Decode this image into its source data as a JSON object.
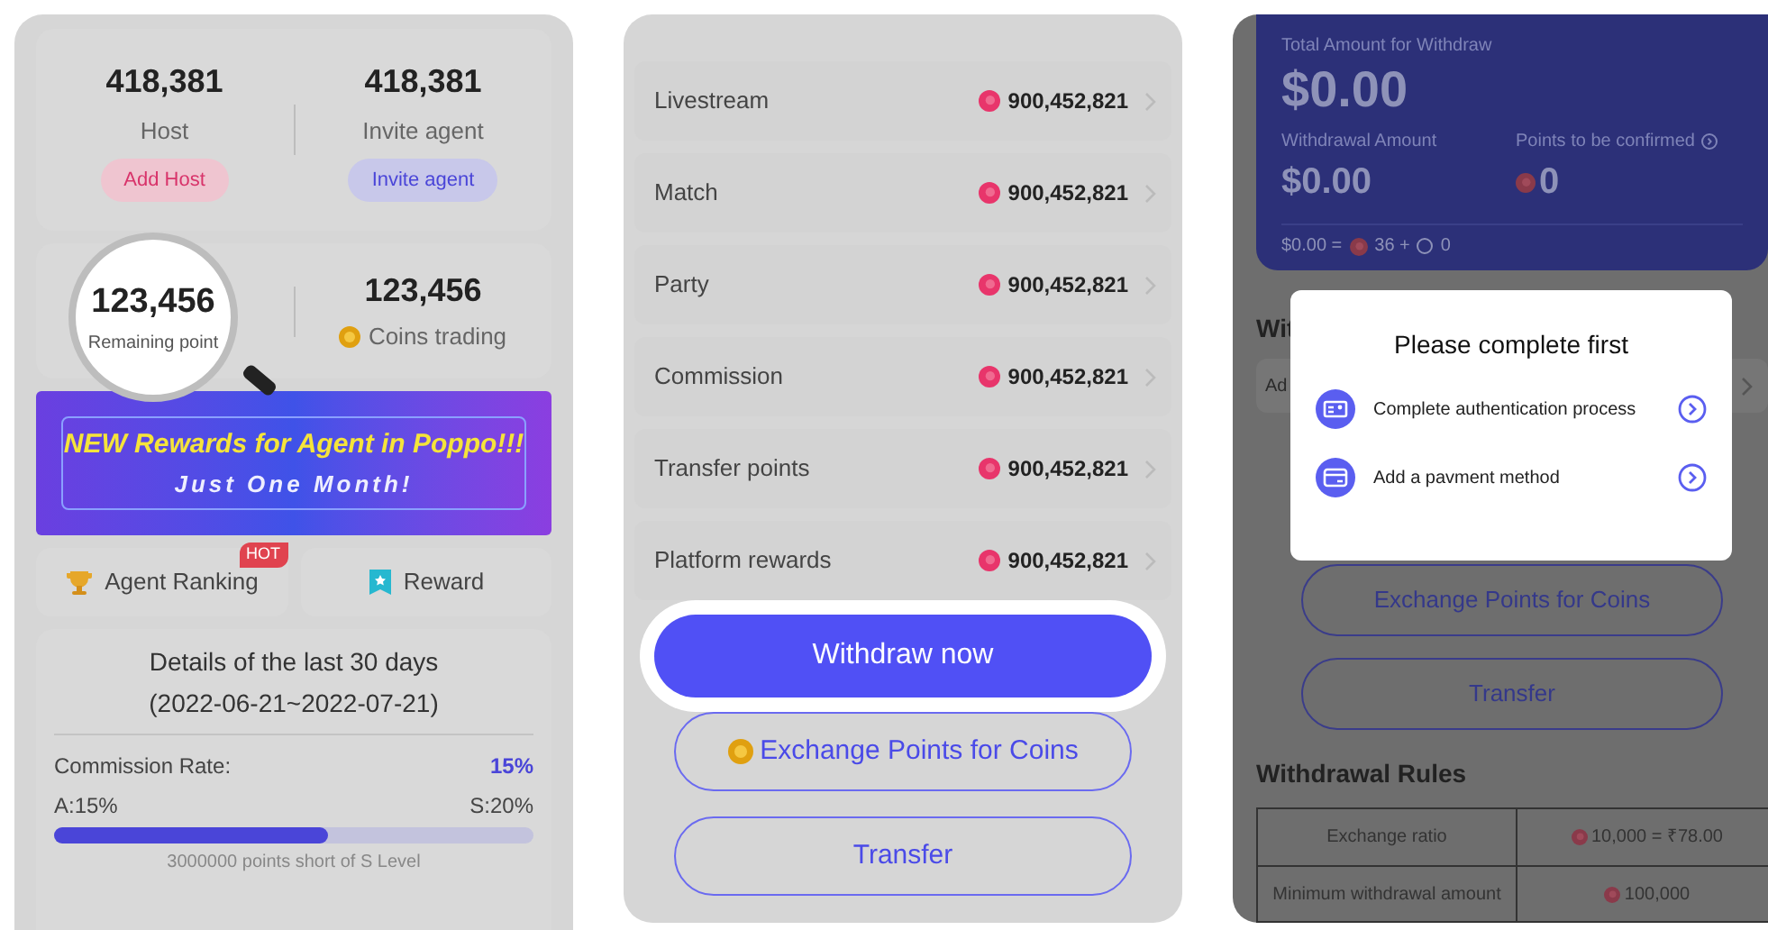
{
  "left": {
    "stats": [
      {
        "value": "418,381",
        "label": "Host",
        "action": {
          "label": "Add Host",
          "kind": "pink"
        }
      },
      {
        "value": "418,381",
        "label": "Invite agent",
        "action": {
          "label": "Invite agent",
          "kind": "violet"
        }
      }
    ],
    "magnified": {
      "value": "123,456",
      "label": "Remaining point"
    },
    "coins": {
      "value": "123,456",
      "label": "Coins trading"
    },
    "banner": {
      "title": "NEW Rewards for Agent in Poppo!!!",
      "subtitle": "Just One Month!"
    },
    "shortcuts": [
      {
        "label": "Agent Ranking",
        "kind": "trophy",
        "badge": "HOT"
      },
      {
        "label": "Reward",
        "kind": "ribbon"
      }
    ],
    "details": {
      "title": "Details of the last 30 days",
      "range": "(2022-06-21~2022-07-21)",
      "rate_label": "Commission Rate:",
      "rate_value": "15%",
      "from": "A:15%",
      "to": "S:20%",
      "level": 0.57,
      "note": "3000000 points short of S Level"
    }
  },
  "middle": {
    "income": [
      {
        "label": "Livestream",
        "amount": "900,452,821"
      },
      {
        "label": "Match",
        "amount": "900,452,821"
      },
      {
        "label": "Party",
        "amount": "900,452,821"
      },
      {
        "label": "Commission",
        "amount": "900,452,821"
      },
      {
        "label": "Transfer points",
        "amount": "900,452,821"
      },
      {
        "label": "Platform rewards",
        "amount": "900,452,821"
      }
    ],
    "buttons": [
      {
        "label": "Withdraw now",
        "kind": "primary",
        "highlighted": true
      },
      {
        "label": "Exchange Points for Coins",
        "kind": "coin",
        "highlighted": false
      },
      {
        "label": "Transfer",
        "kind": "outline",
        "highlighted": false
      }
    ]
  },
  "right": {
    "summary": {
      "title": "Total Amount for Withdraw",
      "total": "$0.00",
      "withdrawal_label": "Withdrawal Amount",
      "withdrawal": "$0.00",
      "points_label": "Points to be confirmed",
      "points": "0",
      "formula_lhs": "$0.00 =",
      "formula_points": "36 +",
      "formula_coins": "0"
    },
    "section_title": "Wit",
    "field": "Ad",
    "dialog": {
      "title": "Please complete first",
      "items": [
        {
          "label": "Complete authentication process",
          "kind": "id-card"
        },
        {
          "label": "Add a pavment method",
          "kind": "card"
        }
      ]
    },
    "buttons": [
      {
        "label": "Exchange Points for Coins"
      },
      {
        "label": "Transfer"
      }
    ],
    "rules": {
      "title": "Withdrawal Rules",
      "rows": [
        {
          "name": "Exchange ratio",
          "value": "10,000 = ₹78.00"
        },
        {
          "name": "Minimum withdrawal amount",
          "value": "100,000"
        }
      ]
    }
  }
}
